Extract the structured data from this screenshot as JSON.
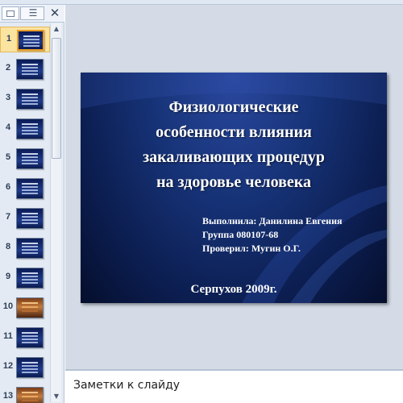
{
  "thumbnails": [
    {
      "number": "1",
      "kind": "text",
      "selected": true
    },
    {
      "number": "2",
      "kind": "text"
    },
    {
      "number": "3",
      "kind": "text"
    },
    {
      "number": "4",
      "kind": "text"
    },
    {
      "number": "5",
      "kind": "text"
    },
    {
      "number": "6",
      "kind": "text"
    },
    {
      "number": "7",
      "kind": "text"
    },
    {
      "number": "8",
      "kind": "text"
    },
    {
      "number": "9",
      "kind": "text"
    },
    {
      "number": "10",
      "kind": "photo"
    },
    {
      "number": "11",
      "kind": "text"
    },
    {
      "number": "12",
      "kind": "text"
    },
    {
      "number": "13",
      "kind": "photo"
    }
  ],
  "pane": {
    "close_glyph": "✕",
    "outline_glyph": "☰"
  },
  "slide": {
    "title_lines": [
      "Физиологические",
      "особенности влияния",
      "закаливающих процедур",
      "на здоровье человека"
    ],
    "author": "Выполнила: Данилина Евгения",
    "group": "Группа 080107-68",
    "checked_by": "Проверил: Мугин О.Г.",
    "footer": "Серпухов 2009г."
  },
  "notes": {
    "placeholder": "Заметки к слайду"
  },
  "colors": {
    "slide_background": "#163276",
    "selection": "#fbe3a0"
  }
}
